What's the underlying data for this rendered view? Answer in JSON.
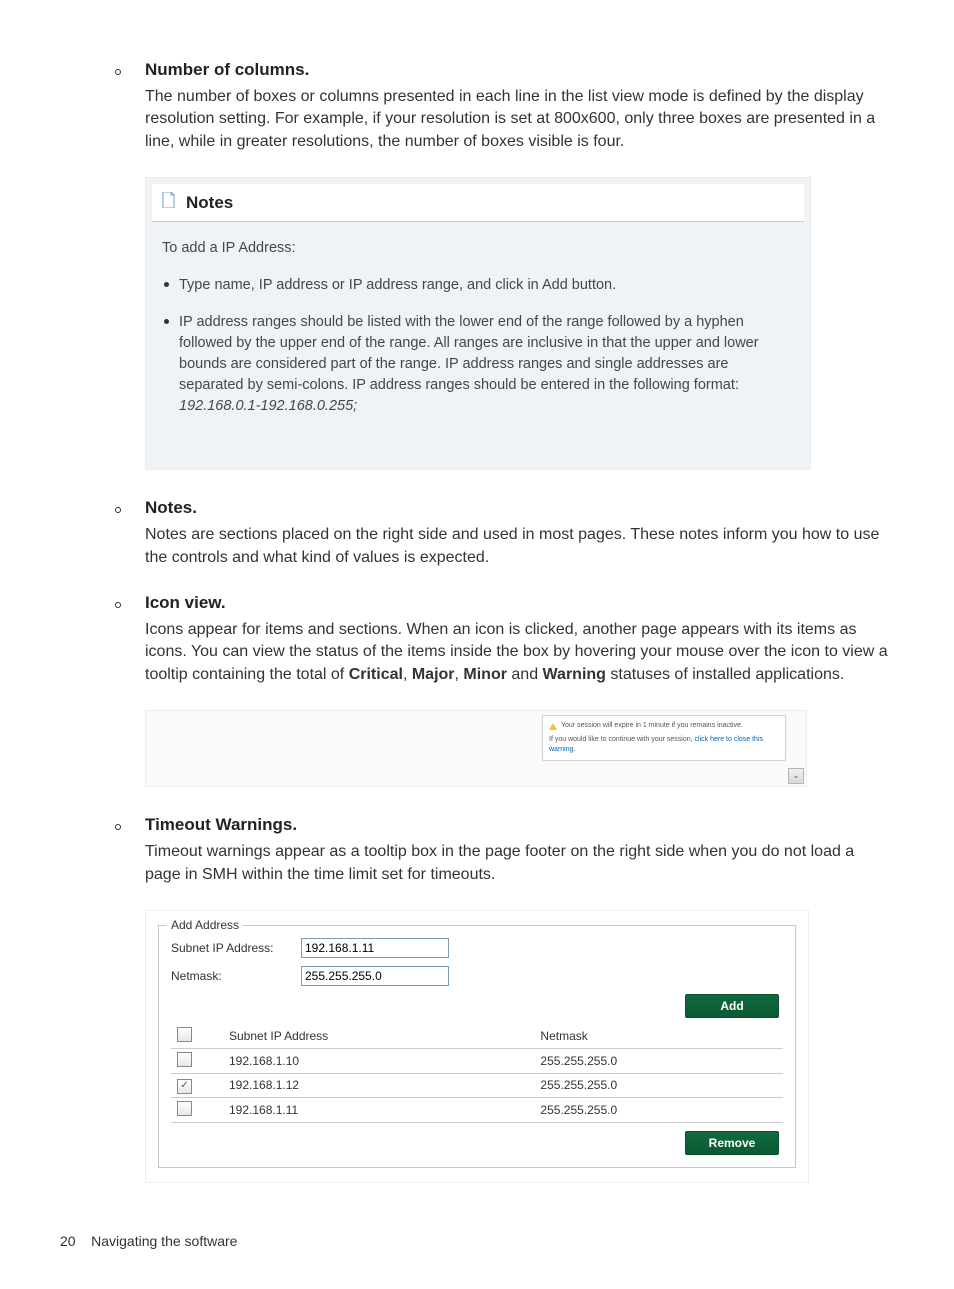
{
  "sections": {
    "numCols": {
      "title": "Number of columns.",
      "body": "The number of boxes or columns presented in each line in the list view mode is defined by the display resolution setting. For example, if your resolution is set at 800x600, only three boxes are presented in a line, while in greater resolutions, the number of boxes visible is four."
    },
    "notes": {
      "title": "Notes.",
      "body": "Notes are sections placed on the right side and used in most pages. These notes inform you how to use the controls and what kind of values is expected."
    },
    "iconView": {
      "title": "Icon view.",
      "body_pre": "Icons appear for items and sections. When an icon is clicked, another page appears with its items as icons. You can view the status of the items inside the box by hovering your mouse over the icon to view a tooltip containing the total of ",
      "b1": "Critical",
      "b2": "Major",
      "b3": "Minor",
      "b4": "Warning",
      "body_post": " statuses of installed applications."
    },
    "timeout": {
      "title": "Timeout Warnings.",
      "body": "Timeout warnings appear as a tooltip box in the page footer on the right side when you do not load a page in SMH within the time limit set for timeouts."
    }
  },
  "notesBox": {
    "header": "Notes",
    "lead": "To add a IP Address:",
    "bullet1": "Type name, IP address or IP address range, and click in Add button.",
    "bullet2": "IP address ranges should be listed with the lower end of the range followed by a hyphen followed by the upper end of the range. All ranges are inclusive in that the upper and lower bounds are considered part of the range. IP address ranges and single addresses are separated by semi-colons. IP address ranges should be entered in the following format:",
    "bullet2_example": "192.168.0.1-192.168.0.255;"
  },
  "timeoutBox": {
    "warn": "Your session will expire in 1 minute if you remains inactive.",
    "line2_pre": "If you would like to continue with your session, ",
    "link": "click here to close this warning",
    "line2_post": "."
  },
  "addrBox": {
    "legend": "Add Address",
    "subnetLabel": "Subnet IP Address:",
    "netmaskLabel": "Netmask:",
    "subnetValue": "192.168.1.11",
    "netmaskValue": "255.255.255.0",
    "addBtn": "Add",
    "removeBtn": "Remove",
    "colSubnet": "Subnet IP Address",
    "colNetmask": "Netmask",
    "rows": [
      {
        "checked": false,
        "ip": "192.168.1.10",
        "mask": "255.255.255.0"
      },
      {
        "checked": true,
        "ip": "192.168.1.12",
        "mask": "255.255.255.0"
      },
      {
        "checked": false,
        "ip": "192.168.1.11",
        "mask": "255.255.255.0"
      }
    ]
  },
  "footer": {
    "pageNum": "20",
    "title": "Navigating the software"
  }
}
